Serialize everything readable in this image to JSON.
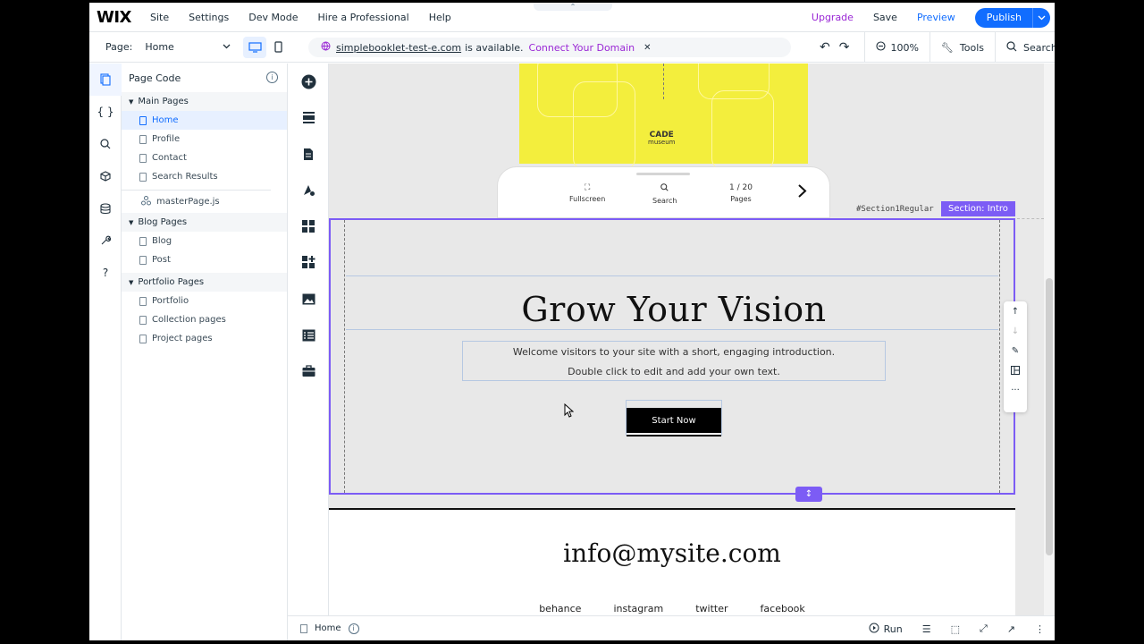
{
  "topbar": {
    "logo": "WIX",
    "menu": [
      "Site",
      "Settings",
      "Dev Mode",
      "Hire a Professional",
      "Help"
    ],
    "upgrade": "Upgrade",
    "save": "Save",
    "preview": "Preview",
    "publish": "Publish",
    "collapse_arrow": "⌃"
  },
  "bar2": {
    "page_label": "Page:",
    "page_value": "Home",
    "domain": "simplebooklet-test-e.com",
    "domain_suffix": "is available.",
    "connect": "Connect Your Domain",
    "zoom": "100%",
    "tools": "Tools",
    "search": "Search"
  },
  "panel": {
    "title": "Page Code",
    "groups": [
      {
        "name": "Main Pages",
        "pages": [
          "Home",
          "Profile",
          "Contact",
          "Search Results"
        ]
      },
      {
        "name": "Blog Pages",
        "pages": [
          "Blog",
          "Post"
        ]
      },
      {
        "name": "Portfolio Pages",
        "pages": [
          "Portfolio",
          "Collection pages",
          "Project pages"
        ]
      }
    ],
    "master_page": "masterPage.js",
    "selected_page": "Home"
  },
  "rail_icons": [
    "pages-icon",
    "code-braces-icon",
    "search-icon",
    "package-icon",
    "database-icon",
    "wrench-icon",
    "help-icon"
  ],
  "tool_icons": [
    "add-icon",
    "sections-icon",
    "page-icon",
    "design-icon",
    "apps-icon",
    "add-apps-icon",
    "media-icon",
    "cms-icon",
    "business-icon"
  ],
  "canvas": {
    "booklet": {
      "brand": "CADE",
      "brand_sub": "museum",
      "fullscreen": "Fullscreen",
      "search": "Search",
      "page_count": "1 / 20",
      "pages": "Pages"
    },
    "section_id": "#Section1Regular",
    "section_tag": "Section: Intro",
    "hero_title": "Grow Your Vision",
    "intro_line1": "Welcome visitors to your site with a short, engaging introduction.",
    "intro_line2": "Double click to edit and add your own text.",
    "button": "Start Now",
    "email": "info@mysite.com",
    "social": [
      "behance",
      "instagram",
      "twitter",
      "facebook"
    ]
  },
  "bottombar": {
    "page": "Home",
    "run": "Run"
  },
  "colors": {
    "accent": "#116dff",
    "upgrade": "#9a27d5",
    "section": "#7c5cf5",
    "booklet": "#f3ee3d"
  }
}
